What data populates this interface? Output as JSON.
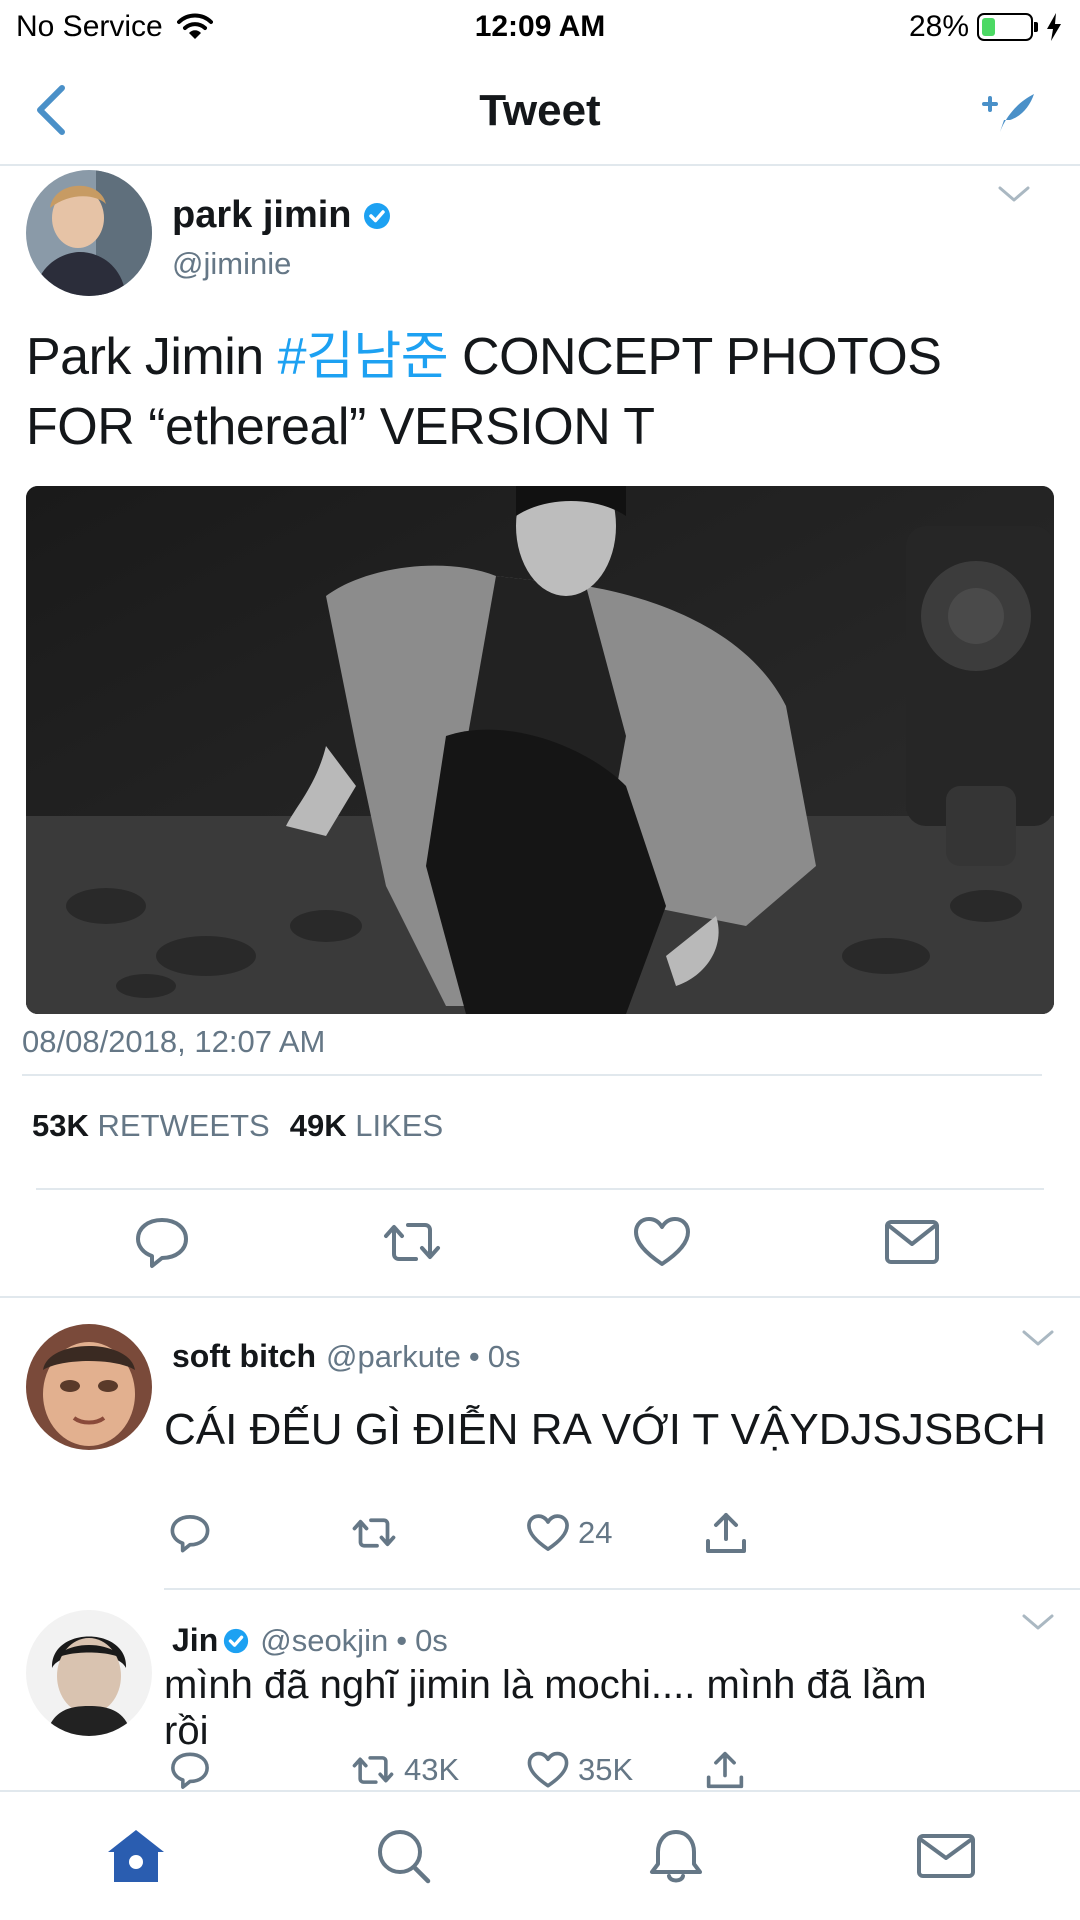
{
  "status_bar": {
    "carrier": "No Service",
    "time": "12:09 AM",
    "battery_percent": "28%",
    "battery_level": 0.28,
    "battery_color": "#4cd964"
  },
  "nav": {
    "title": "Tweet",
    "back_icon": "chevron-left-icon",
    "compose_icon": "compose-tweet-icon"
  },
  "main_tweet": {
    "name": "park jimin",
    "handle": "@jiminie",
    "text_before": "Park Jimin ",
    "hashtag": "#김남준",
    "text_after": " CONCEPT PHOTOS FOR “ethereal” VERSION T",
    "timestamp": "08/08/2018, 12:07 AM",
    "retweets_count": "53K",
    "retweets_label": "RETWEETS",
    "likes_count": "49K",
    "likes_label": "LIKES",
    "actions": [
      "reply-icon",
      "retweet-icon",
      "like-icon",
      "direct-message-icon"
    ]
  },
  "replies": [
    {
      "name": "soft bitch",
      "handle": "@parkute",
      "sep": "•",
      "time": "0s",
      "text": "CÁI ĐẾU GÌ ĐIỄN RA VỚI T VẬYDJSJSBCH",
      "reply_count": "",
      "retweet_count": "",
      "like_count": "24"
    },
    {
      "name": "Jin",
      "handle": "@seokjin",
      "sep": "•",
      "time": "0s",
      "text": "mình đã nghĩ jimin là mochi.... mình đã lầm rồi",
      "reply_count": "",
      "retweet_count": "43K",
      "like_count": "35K"
    }
  ],
  "tab_bar": [
    "home-icon",
    "search-icon",
    "notifications-icon",
    "messages-icon"
  ],
  "colors": {
    "accent": "#1da1f2",
    "nav_icon": "#4a90c8",
    "home_active": "#2a5db0",
    "secondary_text": "#657786",
    "divider": "#e1e8ed"
  }
}
